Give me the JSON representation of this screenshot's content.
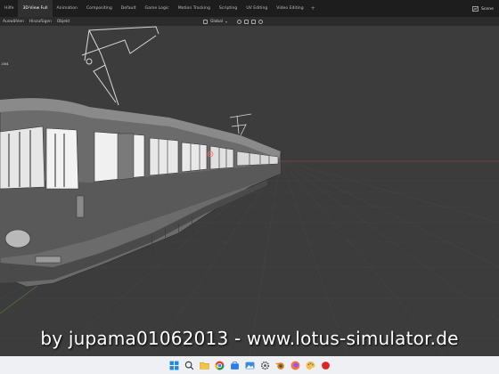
{
  "topbar": {
    "tabs": [
      {
        "label": "Hilfe",
        "active": false
      },
      {
        "label": "3D-View Full",
        "active": true
      },
      {
        "label": "Animation",
        "active": false
      },
      {
        "label": "Compositing",
        "active": false
      },
      {
        "label": "Default",
        "active": false
      },
      {
        "label": "Game Logic",
        "active": false
      },
      {
        "label": "Motion Tracking",
        "active": false
      },
      {
        "label": "Scripting",
        "active": false
      },
      {
        "label": "UV Editing",
        "active": false
      },
      {
        "label": "Video Editing",
        "active": false
      }
    ],
    "add_symbol": "+",
    "scene_label": "Scene"
  },
  "viewport_header": {
    "menus": [
      "Auswählen",
      "Hinzufügen",
      "Objekt"
    ],
    "orientation": "Global"
  },
  "viewport": {
    "object_label": ".004",
    "background_color": "#3c3c3c"
  },
  "watermark": "by jupama01062013 - www.lotus-simulator.de",
  "taskbar": {
    "icons": [
      "windows-start-icon",
      "search-icon",
      "file-explorer-icon",
      "chrome-icon",
      "store-icon",
      "photos-icon",
      "settings-icon",
      "blender-icon",
      "firefox-icon",
      "paint-icon",
      "record-icon"
    ]
  }
}
